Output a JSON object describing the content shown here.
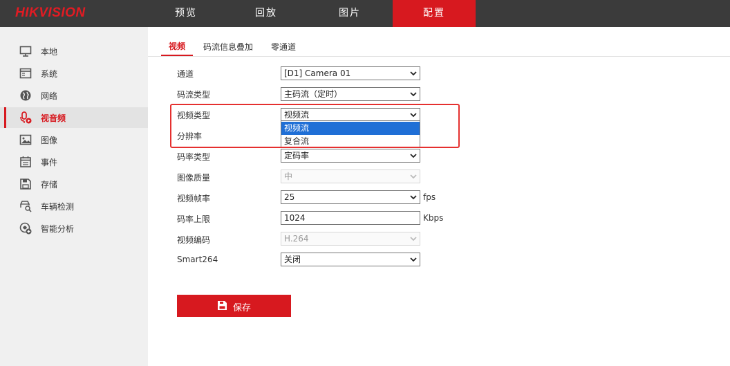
{
  "brand": "HIKVISION",
  "nav": {
    "items": [
      {
        "label": "预览",
        "active": false
      },
      {
        "label": "回放",
        "active": false
      },
      {
        "label": "图片",
        "active": false
      },
      {
        "label": "配置",
        "active": true
      }
    ],
    "active_color": "#d7191f",
    "bar_color": "#3b3b3b"
  },
  "sidebar": {
    "items": [
      {
        "label": "本地",
        "icon": "monitor-icon"
      },
      {
        "label": "系统",
        "icon": "system-window-icon"
      },
      {
        "label": "网络",
        "icon": "globe-icon"
      },
      {
        "label": "视音频",
        "icon": "microphone-play-icon",
        "active": true
      },
      {
        "label": "图像",
        "icon": "image-icon"
      },
      {
        "label": "事件",
        "icon": "calendar-icon"
      },
      {
        "label": "存储",
        "icon": "floppy-disk-icon"
      },
      {
        "label": "车辆检测",
        "icon": "vehicle-search-icon"
      },
      {
        "label": "智能分析",
        "icon": "smart-analysis-icon"
      }
    ]
  },
  "tabs": [
    {
      "label": "视频",
      "active": true
    },
    {
      "label": "码流信息叠加"
    },
    {
      "label": "零通道"
    }
  ],
  "form": {
    "channel": {
      "label": "通道",
      "value": "[D1] Camera 01"
    },
    "stream_type": {
      "label": "码流类型",
      "value": "主码流（定时）"
    },
    "video_type": {
      "label": "视频类型",
      "value": "视频流",
      "options": [
        "视频流",
        "复合流"
      ],
      "highlighted_option": "视频流"
    },
    "resolution": {
      "label": "分辨率"
    },
    "bitrate_type": {
      "label": "码率类型",
      "value": "定码率"
    },
    "image_quality": {
      "label": "图像质量",
      "value": "中",
      "disabled": true
    },
    "frame_rate": {
      "label": "视频帧率",
      "value": "25",
      "unit": "fps"
    },
    "max_bitrate": {
      "label": "码率上限",
      "value": "1024",
      "unit": "Kbps"
    },
    "video_encoding": {
      "label": "视频编码",
      "value": "H.264",
      "disabled": true
    },
    "smart264": {
      "label": "Smart264",
      "value": "关闭"
    }
  },
  "save_button": {
    "label": "保存",
    "icon": "floppy-disk-icon"
  },
  "colors": {
    "accent": "#d7191f",
    "highlight_frame": "#e5302f",
    "option_selected": "#1f6fd6"
  }
}
